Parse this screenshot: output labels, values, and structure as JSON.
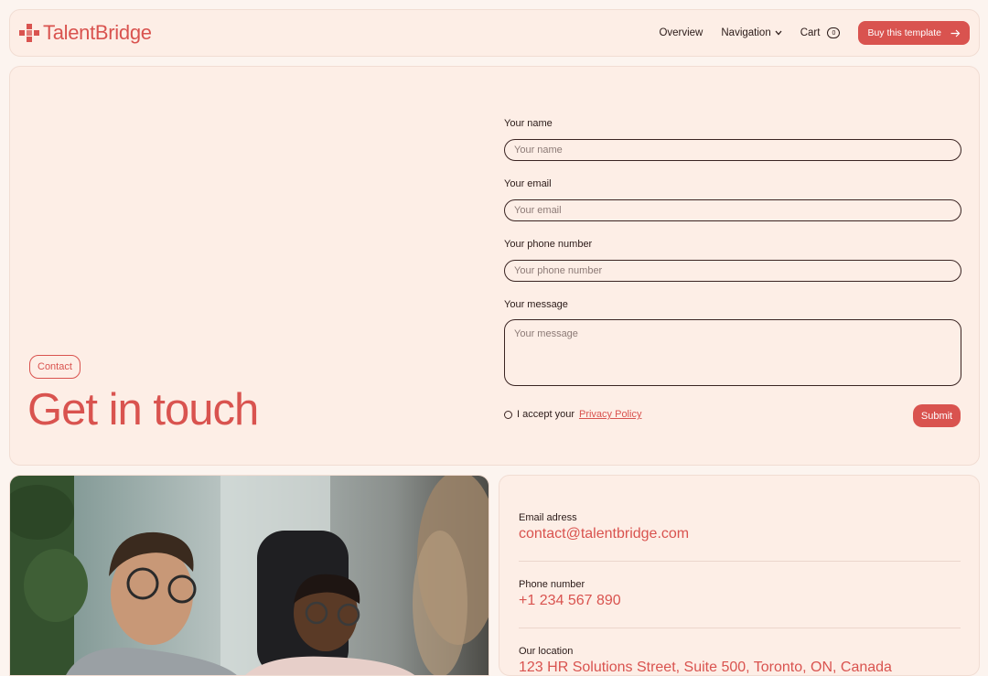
{
  "brand": {
    "name": "TalentBridge",
    "color": "#d9534f"
  },
  "nav": {
    "overview": "Overview",
    "navigation": "Navigation",
    "cart": "Cart",
    "cart_count": "0",
    "buy": "Buy this template"
  },
  "hero": {
    "badge": "Contact",
    "title": "Get in touch"
  },
  "form": {
    "name_label": "Your name",
    "name_placeholder": "Your name",
    "email_label": "Your email",
    "email_placeholder": "Your email",
    "phone_label": "Your phone number",
    "phone_placeholder": "Your phone number",
    "message_label": "Your message",
    "message_placeholder": "Your message",
    "accept_text": "I accept your",
    "policy_link": "Privacy Policy",
    "submit": "Submit"
  },
  "contact": {
    "email_label": "Email adress",
    "email_value": "contact@talentbridge.com",
    "phone_label": "Phone number",
    "phone_value": "+1 234 567 890",
    "location_label": "Our location",
    "location_value": "123 HR Solutions Street, Suite 500, Toronto, ON, Canada"
  }
}
